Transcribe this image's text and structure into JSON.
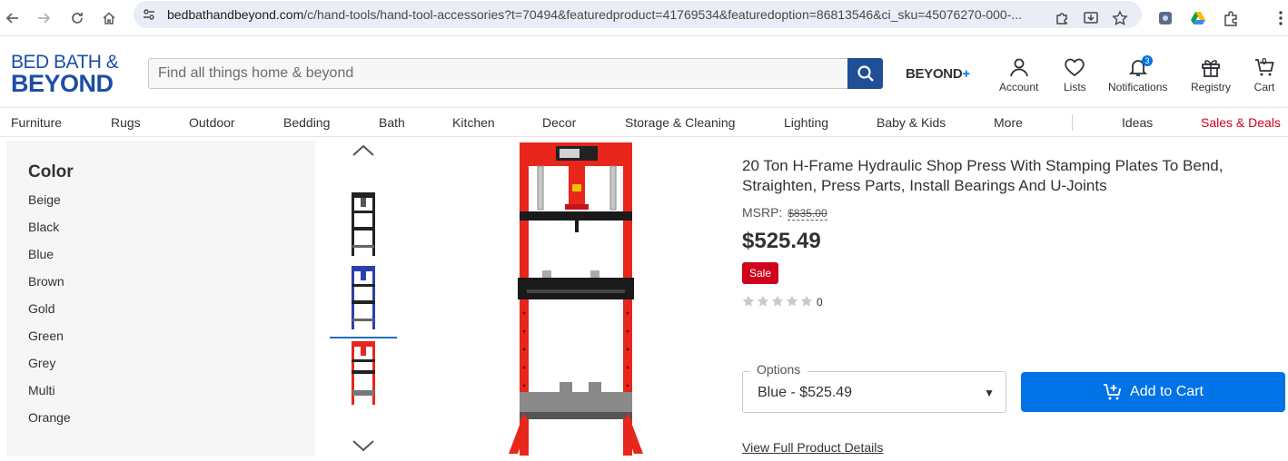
{
  "browser": {
    "url_host": "bedbathandbeyond.com",
    "url_path": "/c/hand-tools/hand-tool-accessories?t=70494&featuredproduct=41769534&featuredoption=86813546&ci_sku=45076270-000-..."
  },
  "header": {
    "logo_line1": "BED BATH &",
    "logo_line2": "BEYOND",
    "search_placeholder": "Find all things home & beyond",
    "beyond_label": "BEYOND",
    "beyond_plus": "+",
    "account_label": "Account",
    "lists_label": "Lists",
    "notifications_label": "Notifications",
    "notifications_count": "3",
    "registry_label": "Registry",
    "cart_label": "Cart",
    "cart_count": "0"
  },
  "nav": {
    "items": [
      "Furniture",
      "Rugs",
      "Outdoor",
      "Bedding",
      "Bath",
      "Kitchen",
      "Decor",
      "Storage & Cleaning",
      "Lighting",
      "Baby & Kids",
      "More"
    ],
    "ideas": "Ideas",
    "sales": "Sales & Deals"
  },
  "filters": {
    "title": "Color",
    "options": [
      "Beige",
      "Black",
      "Blue",
      "Brown",
      "Gold",
      "Green",
      "Grey",
      "Multi",
      "Orange"
    ]
  },
  "product": {
    "title": "20 Ton H-Frame Hydraulic Shop Press With Stamping Plates To Bend, Straighten, Press Parts, Install Bearings And U-Joints",
    "msrp_label": "MSRP:",
    "msrp_value": "$835.00",
    "price": "$525.49",
    "sale_badge": "Sale",
    "rating_count": "0",
    "options_label": "Options",
    "options_value": "Blue - $525.49",
    "add_to_cart": "Add to Cart",
    "details_link": "View Full Product Details"
  },
  "colors": {
    "brand_blue": "#1c4ea8",
    "search_button": "#1e4f97",
    "cta_blue": "#0073e6",
    "sale_red": "#d0021b",
    "press_red": "#e8261b"
  }
}
